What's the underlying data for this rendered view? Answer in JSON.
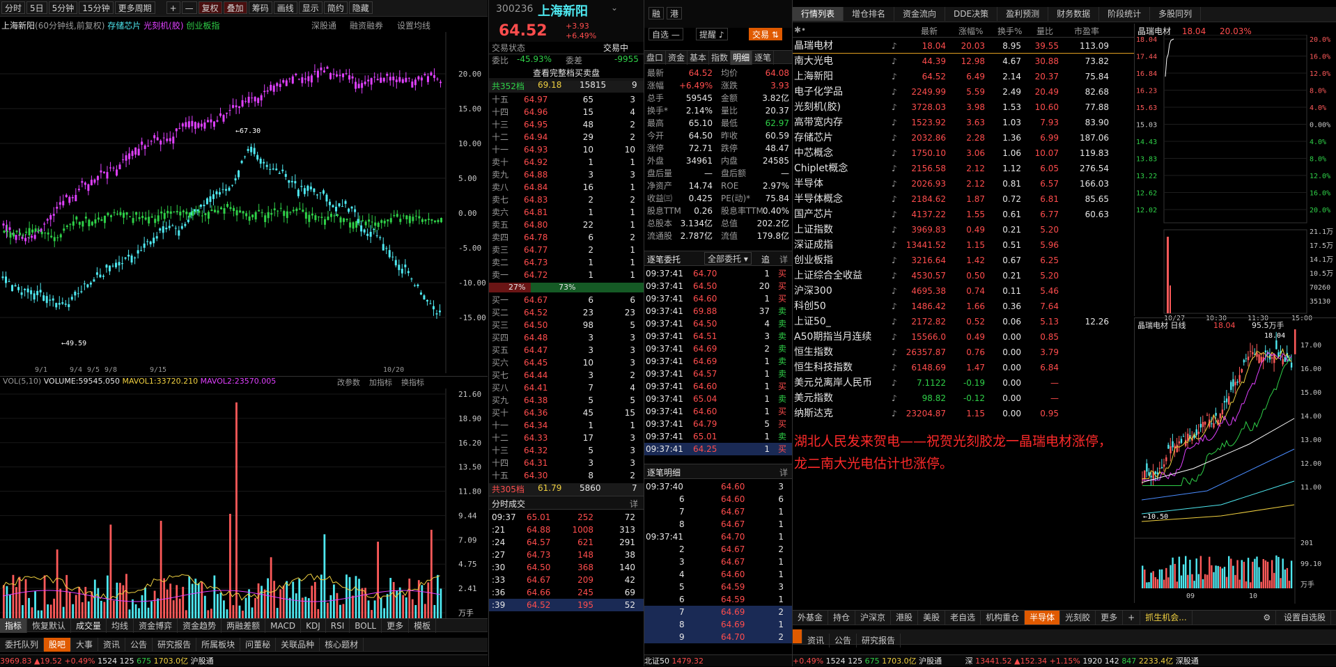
{
  "toolbar": {
    "items": [
      "分时",
      "5日",
      "5分钟",
      "15分钟",
      "更多周期",
      "+",
      "—",
      "复权",
      "叠加",
      "筹码",
      "画线",
      "显示",
      "简约",
      "隐藏"
    ]
  },
  "kchart": {
    "title": "上海新阳",
    "info": "(60分钟线,前复权)",
    "overlays": [
      "存储芯片",
      "光刻机(胶)",
      "创业板指"
    ],
    "links": [
      "深股通",
      "融资融券",
      "设置均线"
    ],
    "yaxis": [
      "20.00",
      "15.00",
      "10.00",
      "5.00",
      "0.00",
      "-5.00",
      "-10.00",
      "-15.00"
    ],
    "maxLabel": "67.30",
    "minLabel": "49.59",
    "xaxis": [
      "9/1",
      "9/4",
      "9/5",
      "9/8",
      "9/15",
      "10/20"
    ],
    "volTitle": "VOL(5,10)",
    "volume": "VOLUME:59545.050",
    "mavol1": "MAVOL1:33720.210",
    "mavol2": "MAVOL2:23570.005",
    "volLinks": [
      "改参数",
      "加指标",
      "换指标"
    ],
    "vyaxis": [
      "21.60",
      "18.90",
      "16.20",
      "13.50",
      "11.80",
      "9.44",
      "7.09",
      "4.75",
      "2.41",
      "万手"
    ],
    "indTabs": [
      "指标",
      "恢复默认",
      "成交量",
      "均线",
      "资金博弈",
      "资金趋势",
      "两融差额",
      "MACD",
      "KDJ",
      "RSI",
      "BOLL",
      "更多",
      "模板"
    ],
    "bottomTabs": [
      "委托队列",
      "股吧",
      "大事",
      "资讯",
      "公告",
      "研究报告",
      "所属板块",
      "问董秘",
      "关联品种",
      "核心题材"
    ]
  },
  "status": {
    "left": "3969.83",
    "lchg": "19.52",
    "lpct": "+0.49%",
    "lv": "1524",
    "la": "125",
    "lb": "675",
    "lamt": "1703.0亿",
    "hk": "沪股通",
    "sz": "深",
    "sv": "13441.52",
    "schg": "152.34",
    "spct": "+1.15%",
    "s1": "1920",
    "s2": "142",
    "s3": "847",
    "samt": "2233.4亿",
    "hk2": "深股通",
    "bz": "北证50",
    "bzv": "1479.32"
  },
  "quote": {
    "code": "300236",
    "name": "上海新阳",
    "price": "64.52",
    "chg": "+3.93",
    "pct": "+6.49%",
    "tags": [
      "融",
      "港"
    ],
    "zixuan": "自选",
    "tixing": "提醒",
    "jiaoyi": "交易",
    "state": "交易状态",
    "stateVal": "交易中",
    "weibi": "委比",
    "weibiVal": "-45.93%",
    "weicha": "委差",
    "weichaVal": "-9955",
    "full": "查看完整档买卖盘",
    "sellTotal": "共352档",
    "sellAvg": "69.18",
    "sellVol": "15815",
    "sellCnt": "9",
    "sells": [
      [
        "十五",
        "64.97",
        "65",
        "3"
      ],
      [
        "十四",
        "64.96",
        "15",
        "4"
      ],
      [
        "十三",
        "64.95",
        "48",
        "2"
      ],
      [
        "十二",
        "64.94",
        "29",
        "2"
      ],
      [
        "十一",
        "64.93",
        "10",
        "10"
      ],
      [
        "卖十",
        "64.92",
        "1",
        "1"
      ],
      [
        "卖九",
        "64.88",
        "3",
        "3"
      ],
      [
        "卖八",
        "64.84",
        "16",
        "1"
      ],
      [
        "卖七",
        "64.83",
        "2",
        "2"
      ],
      [
        "卖六",
        "64.81",
        "1",
        "1"
      ],
      [
        "卖五",
        "64.80",
        "22",
        "1"
      ],
      [
        "卖四",
        "64.78",
        "6",
        "2"
      ],
      [
        "卖三",
        "64.77",
        "2",
        "1"
      ],
      [
        "卖二",
        "64.73",
        "1",
        "1"
      ],
      [
        "卖一",
        "64.72",
        "1",
        "1"
      ]
    ],
    "ratioL": "27%",
    "ratioR": "73%",
    "buys": [
      [
        "买一",
        "64.67",
        "6",
        "6"
      ],
      [
        "买二",
        "64.52",
        "23",
        "23"
      ],
      [
        "买三",
        "64.50",
        "98",
        "5"
      ],
      [
        "买四",
        "64.48",
        "3",
        "3"
      ],
      [
        "买五",
        "64.47",
        "3",
        "3"
      ],
      [
        "买六",
        "64.45",
        "10",
        "3"
      ],
      [
        "买七",
        "64.44",
        "3",
        "2"
      ],
      [
        "买八",
        "64.41",
        "7",
        "4"
      ],
      [
        "买九",
        "64.38",
        "5",
        "5"
      ],
      [
        "买十",
        "64.36",
        "45",
        "15"
      ],
      [
        "十一",
        "64.34",
        "1",
        "1"
      ],
      [
        "十二",
        "64.33",
        "17",
        "3"
      ],
      [
        "十三",
        "64.32",
        "5",
        "3"
      ],
      [
        "十四",
        "64.31",
        "3",
        "3"
      ],
      [
        "十五",
        "64.30",
        "8",
        "2"
      ]
    ],
    "buyTotal": "共305档",
    "buyAvg": "61.79",
    "buyVol": "5860",
    "buyCnt": "7",
    "minTitle": "分时成交",
    "minMore": "详",
    "mins": [
      [
        "09:37",
        "65.01",
        "252",
        "72"
      ],
      [
        ":21",
        "64.88",
        "1008",
        "313"
      ],
      [
        ":24",
        "64.57",
        "621",
        "291"
      ],
      [
        ":27",
        "64.73",
        "148",
        "38"
      ],
      [
        ":30",
        "64.50",
        "368",
        "140"
      ],
      [
        ":33",
        "64.67",
        "209",
        "42"
      ],
      [
        ":36",
        "64.66",
        "245",
        "69"
      ],
      [
        ":39",
        "64.52",
        "195",
        "52"
      ]
    ]
  },
  "detail": {
    "tabs": [
      "盘口",
      "资金",
      "基本",
      "指数",
      "明细",
      "逐笔"
    ],
    "rows": [
      [
        "最新",
        "64.52",
        "均价",
        "64.08"
      ],
      [
        "涨幅",
        "+6.49%",
        "涨跌",
        "3.93"
      ],
      [
        "总手",
        "59545",
        "金额",
        "3.82亿"
      ],
      [
        "换手*",
        "2.14%",
        "量比",
        "20.37"
      ],
      [
        "最高",
        "65.10",
        "最低",
        "62.97"
      ],
      [
        "今开",
        "64.50",
        "昨收",
        "60.59"
      ],
      [
        "涨停",
        "72.71",
        "跌停",
        "48.47"
      ],
      [
        "外盘",
        "34961",
        "内盘",
        "24585"
      ],
      [
        "盘后量",
        "—",
        "盘后额",
        "—"
      ],
      [
        "净资产",
        "14.74",
        "ROE",
        "2.97%"
      ],
      [
        "收益㈢",
        "0.425",
        "PE(动)*",
        "75.84"
      ],
      [
        "股息TTM",
        "0.26",
        "股息率TTM",
        "0.40%"
      ],
      [
        "总股本",
        "3.134亿",
        "总值",
        "202.2亿"
      ],
      [
        "流通股",
        "2.787亿",
        "流值",
        "179.8亿"
      ]
    ],
    "zbTitle": "逐笔委托",
    "zbFilter": "全部委托",
    "zbBtn": "追",
    "zbMore": "详",
    "zb": [
      [
        "09:37:41",
        "64.70",
        "1",
        "买"
      ],
      [
        "09:37:41",
        "64.50",
        "20",
        "买"
      ],
      [
        "09:37:41",
        "64.60",
        "1",
        "买"
      ],
      [
        "09:37:41",
        "69.88",
        "37",
        "卖"
      ],
      [
        "09:37:41",
        "64.50",
        "4",
        "卖"
      ],
      [
        "09:37:41",
        "64.51",
        "3",
        "卖"
      ],
      [
        "09:37:41",
        "64.69",
        "2",
        "卖"
      ],
      [
        "09:37:41",
        "64.69",
        "1",
        "卖"
      ],
      [
        "09:37:41",
        "64.57",
        "1",
        "卖"
      ],
      [
        "09:37:41",
        "64.60",
        "1",
        "买"
      ],
      [
        "09:37:41",
        "65.04",
        "1",
        "卖"
      ],
      [
        "09:37:41",
        "64.60",
        "1",
        "买"
      ],
      [
        "09:37:41",
        "64.79",
        "5",
        "买"
      ],
      [
        "09:37:41",
        "65.01",
        "1",
        "卖"
      ],
      [
        "09:37:41",
        "64.25",
        "1",
        "买"
      ]
    ],
    "mxTitle": "逐笔明细",
    "mxMore": "详",
    "mx": [
      [
        "09:37:40",
        "64.60",
        "3"
      ],
      [
        "6",
        "64.60",
        "6"
      ],
      [
        "7",
        "64.67",
        "1"
      ],
      [
        "8",
        "64.67",
        "1"
      ],
      [
        "09:37:41",
        "64.70",
        "1"
      ],
      [
        "2",
        "64.67",
        "2"
      ],
      [
        "3",
        "64.67",
        "1"
      ],
      [
        "4",
        "64.60",
        "1"
      ],
      [
        "5",
        "64.59",
        "3"
      ],
      [
        "6",
        "64.59",
        "1"
      ],
      [
        "7",
        "64.69",
        "2"
      ],
      [
        "8",
        "64.69",
        "1"
      ],
      [
        "9",
        "64.70",
        "2"
      ]
    ]
  },
  "list": {
    "tabs": [
      "行情列表",
      "增仓排名",
      "资金流向",
      "DDE决策",
      "盈利预测",
      "财务数据",
      "阶段统计",
      "多股同列"
    ],
    "headers": [
      "最新",
      "涨幅%",
      "换手%",
      "量比",
      "市盈率"
    ],
    "rows": [
      [
        "晶瑞电材",
        "18.04",
        "20.03",
        "8.95",
        "39.55",
        "113.09"
      ],
      [
        "南大光电",
        "44.39",
        "12.98",
        "4.67",
        "30.88",
        "73.82"
      ],
      [
        "上海新阳",
        "64.52",
        "6.49",
        "2.14",
        "20.37",
        "75.84"
      ],
      [
        "电子化学品",
        "2249.99",
        "5.59",
        "2.49",
        "20.49",
        "82.68"
      ],
      [
        "光刻机(胶)",
        "3728.03",
        "3.98",
        "1.53",
        "10.60",
        "77.88"
      ],
      [
        "高带宽内存",
        "1523.92",
        "3.63",
        "1.03",
        "7.93",
        "83.90"
      ],
      [
        "存储芯片",
        "2032.86",
        "2.28",
        "1.36",
        "6.99",
        "187.06"
      ],
      [
        "中芯概念",
        "1750.10",
        "3.06",
        "1.06",
        "10.07",
        "119.83"
      ],
      [
        "Chiplet概念",
        "2156.58",
        "2.12",
        "1.12",
        "6.05",
        "276.54"
      ],
      [
        "半导体",
        "2026.93",
        "2.12",
        "0.81",
        "6.57",
        "166.03"
      ],
      [
        "半导体概念",
        "2184.62",
        "1.87",
        "0.72",
        "6.81",
        "85.65"
      ],
      [
        "国产芯片",
        "4137.22",
        "1.55",
        "0.61",
        "6.77",
        "60.63"
      ],
      [
        "上证指数",
        "3969.83",
        "0.49",
        "0.21",
        "5.20",
        ""
      ],
      [
        "深证成指",
        "13441.52",
        "1.15",
        "0.51",
        "5.96",
        ""
      ],
      [
        "创业板指",
        "3216.64",
        "1.42",
        "0.67",
        "6.25",
        ""
      ],
      [
        "上证综合全收益",
        "4530.57",
        "0.50",
        "0.21",
        "5.20",
        ""
      ],
      [
        "沪深300",
        "4695.38",
        "0.74",
        "0.11",
        "5.46",
        ""
      ],
      [
        "科创50",
        "1486.42",
        "1.66",
        "0.36",
        "7.64",
        ""
      ],
      [
        "上证50_",
        "2172.82",
        "0.52",
        "0.06",
        "5.13",
        "12.26"
      ],
      [
        "A50期指当月连续",
        "15566.0",
        "0.49",
        "0.00",
        "0.85",
        ""
      ],
      [
        "恒生指数",
        "26357.87",
        "0.76",
        "0.00",
        "3.79",
        ""
      ],
      [
        "恒生科技指数",
        "6148.69",
        "1.47",
        "0.00",
        "6.84",
        ""
      ],
      [
        "美元兑离岸人民币",
        "7.1122",
        "-0.19",
        "0.00",
        "—",
        ""
      ],
      [
        "美元指数",
        "98.82",
        "-0.12",
        "0.00",
        "—",
        ""
      ],
      [
        "纳斯达克",
        "23204.87",
        "1.15",
        "0.00",
        "0.95",
        ""
      ]
    ],
    "note": "湖北人民发来贺电——祝贺光刻胶龙一晶瑞电材涨停，龙二南大光电估计也涨停。",
    "bottomTabs": [
      "外基金",
      "持仓",
      "沪深京",
      "港股",
      "美股",
      "老自选",
      "机构重仓",
      "半导体",
      "光刻胶",
      "更多",
      "+",
      "抓生机会...",
      "设置自选股"
    ],
    "subTabs": [
      "资讯",
      "公告",
      "研究报告"
    ]
  },
  "mini": {
    "name": "晶瑞电材",
    "price": "18.04",
    "pct": "20.03%",
    "ly": [
      "18.04",
      "17.44",
      "16.84",
      "16.23",
      "15.63",
      "15.03",
      "14.43",
      "13.83",
      "13.22",
      "12.62",
      "12.02"
    ],
    "ry": [
      "20.0%",
      "16.0%",
      "12.0%",
      "8.0%",
      "4.0%",
      "0.00%",
      "4.0%",
      "8.0%",
      "12.0%",
      "16.0%",
      "20.0%"
    ],
    "vy": [
      "21.1万",
      "17.5万",
      "14.1万",
      "10.5万",
      "70260",
      "35130"
    ],
    "xt": [
      "10/27",
      "10:30",
      "11:30",
      "15:00"
    ],
    "dayTitle": "晶瑞电材 日线",
    "dayPrice": "18.04",
    "dayVol": "95.5万手",
    "dmax": "18.04",
    "dmin": "10.50",
    "dy": [
      "17.00",
      "16.00",
      "15.00",
      "14.00",
      "13.00",
      "12.00",
      "11.00"
    ],
    "dvy": [
      "201",
      "99.10",
      "万手"
    ],
    "dx": [
      "09",
      "10"
    ]
  }
}
